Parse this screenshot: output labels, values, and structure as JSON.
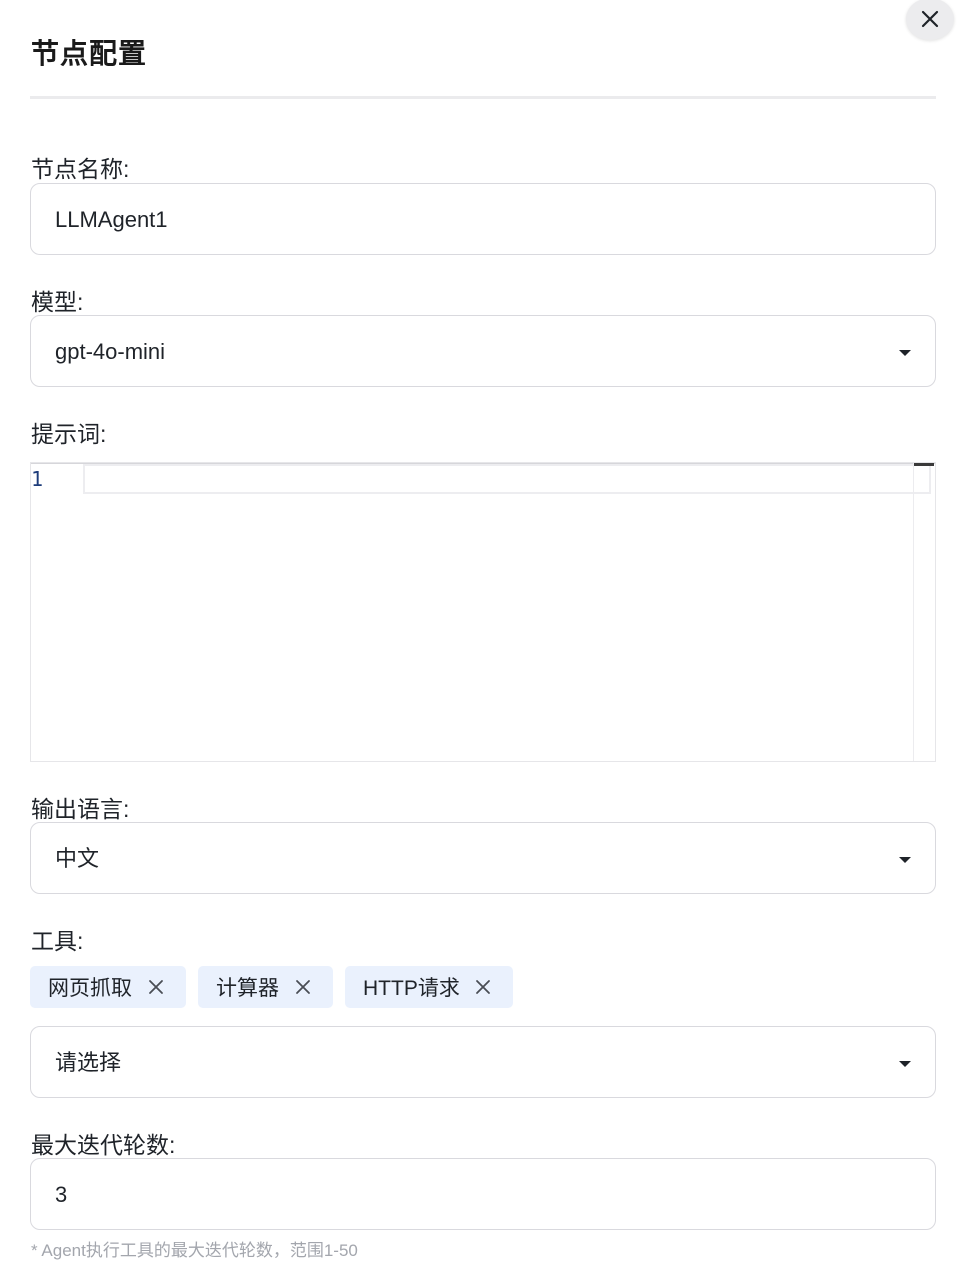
{
  "dialog": {
    "title": "节点配置",
    "close_icon": "close-icon"
  },
  "form": {
    "node_name": {
      "label": "节点名称:",
      "value": "LLMAgent1"
    },
    "model": {
      "label": "模型:",
      "value": "gpt-4o-mini"
    },
    "prompt": {
      "label": "提示词:",
      "line_number": "1",
      "value": ""
    },
    "output_language": {
      "label": "输出语言:",
      "value": "中文"
    },
    "tools": {
      "label": "工具:",
      "selected": [
        "网页抓取",
        "计算器",
        "HTTP请求"
      ],
      "placeholder": "请选择"
    },
    "max_iterations": {
      "label": "最大迭代轮数:",
      "value": "3",
      "hint": "* Agent执行工具的最大迭代轮数，范围1-50"
    }
  },
  "colors": {
    "tag_background": "#eaf1fd",
    "border": "#d9d9de",
    "hint_text": "#a3a6ad"
  }
}
